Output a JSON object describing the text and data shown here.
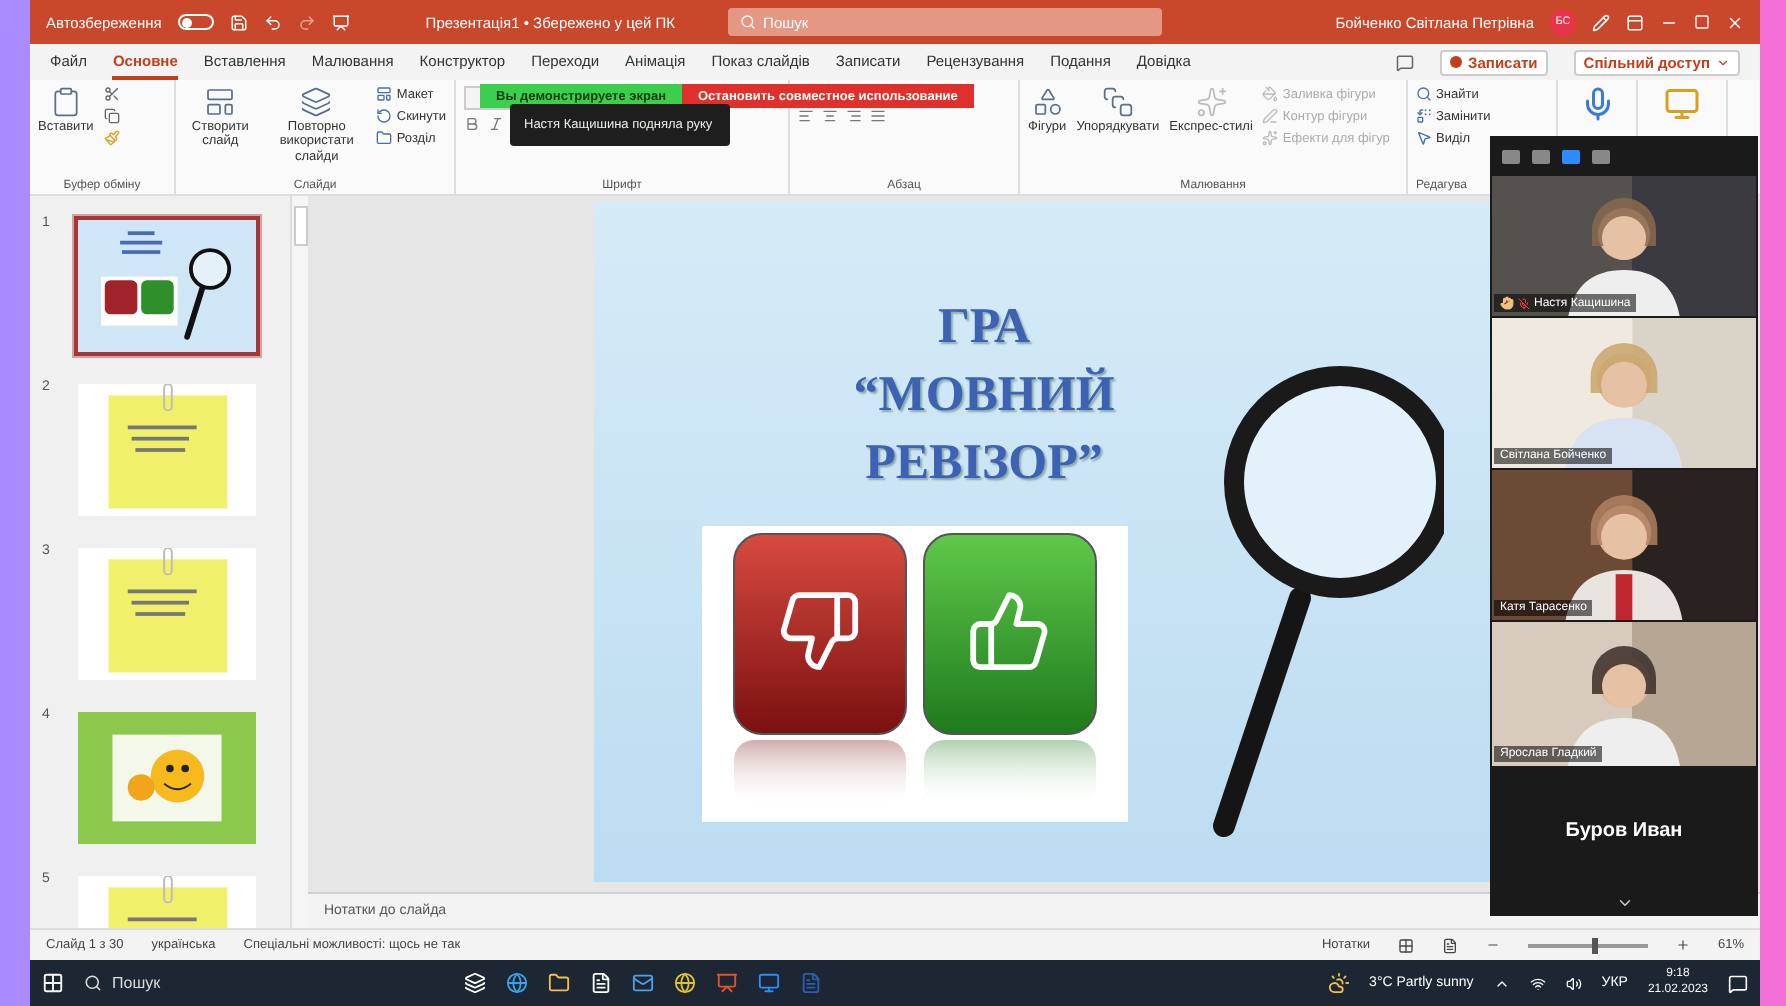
{
  "title_bar": {
    "autosave_label": "Автозбереження",
    "autosave_on": false,
    "document": "Презентація1 • Збережено у цей ПК",
    "search": {
      "placeholder": "Пошук"
    },
    "user": "Бойченко Світлана Петрівна",
    "avatar": "БС"
  },
  "menu": {
    "tabs": [
      {
        "label": "Файл",
        "selected": false
      },
      {
        "label": "Основне",
        "selected": true
      },
      {
        "label": "Вставлення",
        "selected": false
      },
      {
        "label": "Малювання",
        "selected": false
      },
      {
        "label": "Конструктор",
        "selected": false
      },
      {
        "label": "Переходи",
        "selected": false
      },
      {
        "label": "Анімація",
        "selected": false
      },
      {
        "label": "Показ слайдів",
        "selected": false
      },
      {
        "label": "Записати",
        "selected": false
      },
      {
        "label": "Рецензування",
        "selected": false
      },
      {
        "label": "Подання",
        "selected": false
      },
      {
        "label": "Довідка",
        "selected": false
      }
    ],
    "record": "Записати",
    "share": "Спільний доступ"
  },
  "ribbon": {
    "groups": [
      {
        "kind": "clipboard",
        "label": "Буфер обміну",
        "large": [
          "Вставити"
        ]
      },
      {
        "kind": "slides",
        "label": "Слайди",
        "large": [
          "Створити слайд",
          "Повторно використати слайди"
        ],
        "small": [
          {
            "label": "Макет",
            "disabled": false
          },
          {
            "label": "Скинути",
            "disabled": false
          },
          {
            "label": "Розділ",
            "disabled": false
          }
        ]
      },
      {
        "kind": "font",
        "label": "Шрифт"
      },
      {
        "kind": "paragraph",
        "label": "Абзац"
      },
      {
        "kind": "drawing",
        "label": "Малювання",
        "large": [
          "Фігури",
          "Упорядкувати",
          "Експрес-стилі"
        ],
        "small": [
          {
            "label": "Заливка фігури",
            "disabled": true
          },
          {
            "label": "Контур фігури",
            "disabled": true
          },
          {
            "label": "Ефекти для фігур",
            "disabled": true
          }
        ]
      },
      {
        "kind": "editing",
        "label": "Редагува",
        "small": [
          {
            "label": "Знайти",
            "disabled": false
          },
          {
            "label": "Замінити",
            "disabled": false
          },
          {
            "label": "Виділ",
            "disabled": false
          }
        ]
      }
    ]
  },
  "share_banner": {
    "sharing": "Вы демонстрируете экран",
    "stop": "Остановить совместное использование"
  },
  "notification": "Настя Кащишина подняла руку",
  "thumbnails": [
    {
      "number": "1",
      "kind": "title",
      "selected": true
    },
    {
      "number": "2",
      "kind": "note",
      "selected": false
    },
    {
      "number": "3",
      "kind": "note",
      "selected": false
    },
    {
      "number": "4",
      "kind": "smiley",
      "selected": false
    },
    {
      "number": "5",
      "kind": "note",
      "selected": false
    }
  ],
  "slide": {
    "title": [
      "ГРА",
      "“МОВНИЙ",
      "РЕВІЗОР”"
    ]
  },
  "notes": "Нотатки до слайда",
  "status_bar": {
    "slide": "Слайд 1 з 30",
    "language": "українська",
    "accessibility": "Спеціальні можливості: щось не так",
    "notes": "Нотатки",
    "zoom": "61%",
    "zoom_level": {
      "level": 0.55
    }
  },
  "meeting": {
    "view_modes": [
      {
        "selected": false
      },
      {
        "selected": false
      },
      {
        "selected": true
      },
      {
        "selected": false
      }
    ],
    "participants": [
      {
        "name": "Настя Кащишина",
        "kind": "video",
        "hand_raised": true,
        "muted": true
      },
      {
        "name": "Світлана Бойченко",
        "kind": "video",
        "hand_raised": false,
        "muted": false
      },
      {
        "name": "Катя Тарасенко",
        "kind": "video",
        "hand_raised": false,
        "muted": false
      },
      {
        "name": "Ярослав Гладкий",
        "kind": "video",
        "hand_raised": false,
        "muted": false
      },
      {
        "name": "Буров Иван",
        "kind": "name",
        "hand_raised": false,
        "muted": false
      }
    ]
  },
  "taskbar": {
    "search": "Пошук",
    "weather": "3°C Partly sunny",
    "language": "УКР",
    "time": "9:18",
    "date": "21.02.2023"
  }
}
